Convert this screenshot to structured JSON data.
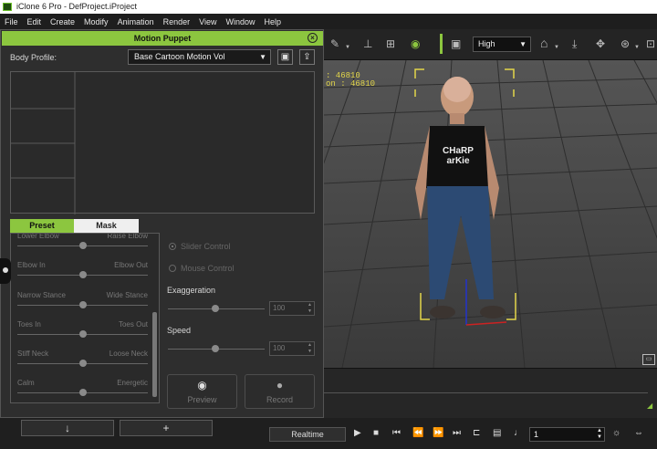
{
  "app": {
    "title": "iClone 6 Pro - DefProject.iProject"
  },
  "menu": [
    "File",
    "Edit",
    "Create",
    "Modify",
    "Animation",
    "Render",
    "View",
    "Window",
    "Help"
  ],
  "toolbar": {
    "quality": "High"
  },
  "viewport": {
    "info_line1": "     : 46810",
    "info_line2": "on : 46810",
    "shirt_text1": "CHaRP",
    "shirt_text2": "arKie"
  },
  "panel": {
    "title": "Motion Puppet",
    "body_profile_label": "Body Profile:",
    "body_profile_value": "Base Cartoon Motion Vol",
    "tabs": [
      "Preset",
      "Mask"
    ],
    "sliders": [
      {
        "left": "Lower Elbow",
        "right": "Raise Elbow",
        "value": 0.5
      },
      {
        "left": "Elbow In",
        "right": "Elbow Out",
        "value": 0.5
      },
      {
        "left": "Narrow Stance",
        "right": "Wide Stance",
        "value": 0.5
      },
      {
        "left": "Toes In",
        "right": "Toes Out",
        "value": 0.5
      },
      {
        "left": "Stiff Neck",
        "right": "Loose Neck",
        "value": 0.5
      },
      {
        "left": "Calm",
        "right": "Energetic",
        "value": 0.5
      }
    ],
    "slider_control_label": "Slider Control",
    "mouse_control_label": "Mouse Control",
    "exaggeration_label": "Exaggeration",
    "exaggeration_value": "100",
    "speed_label": "Speed",
    "speed_value": "100",
    "preview_label": "Preview",
    "record_label": "Record"
  },
  "playback": {
    "mode": "Realtime",
    "frame": "1"
  },
  "colors": {
    "accent": "#8cc63f"
  }
}
